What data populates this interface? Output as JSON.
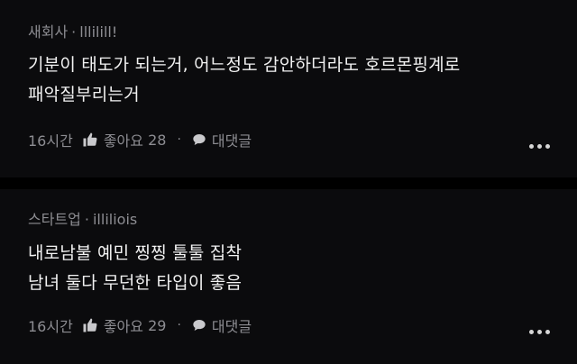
{
  "comments": [
    {
      "author": "새회사",
      "username": "lllilill!",
      "lines": [
        "기분이 태도가 되는거, 어느정도 감안하더라도 호르몬핑계로",
        "패악질부리는거"
      ],
      "time": "16시간",
      "like_label": "좋아요",
      "like_count": "28",
      "reply_label": "대댓글"
    },
    {
      "author": "스타트업",
      "username": "illiliois",
      "lines": [
        "내로남불 예민 찡찡 툴툴 집착",
        "남녀 둘다 무던한 타입이 좋음"
      ],
      "time": "16시간",
      "like_label": "좋아요",
      "like_count": "29",
      "reply_label": "대댓글"
    }
  ],
  "separator": "·",
  "colors": {
    "background": "#0b0b0d",
    "text": "#f2f2f2",
    "muted": "#8d8d92"
  },
  "icons": {
    "like": "thumbs-up-icon",
    "reply": "speech-bubble-icon",
    "more": "more-horizontal-icon"
  }
}
